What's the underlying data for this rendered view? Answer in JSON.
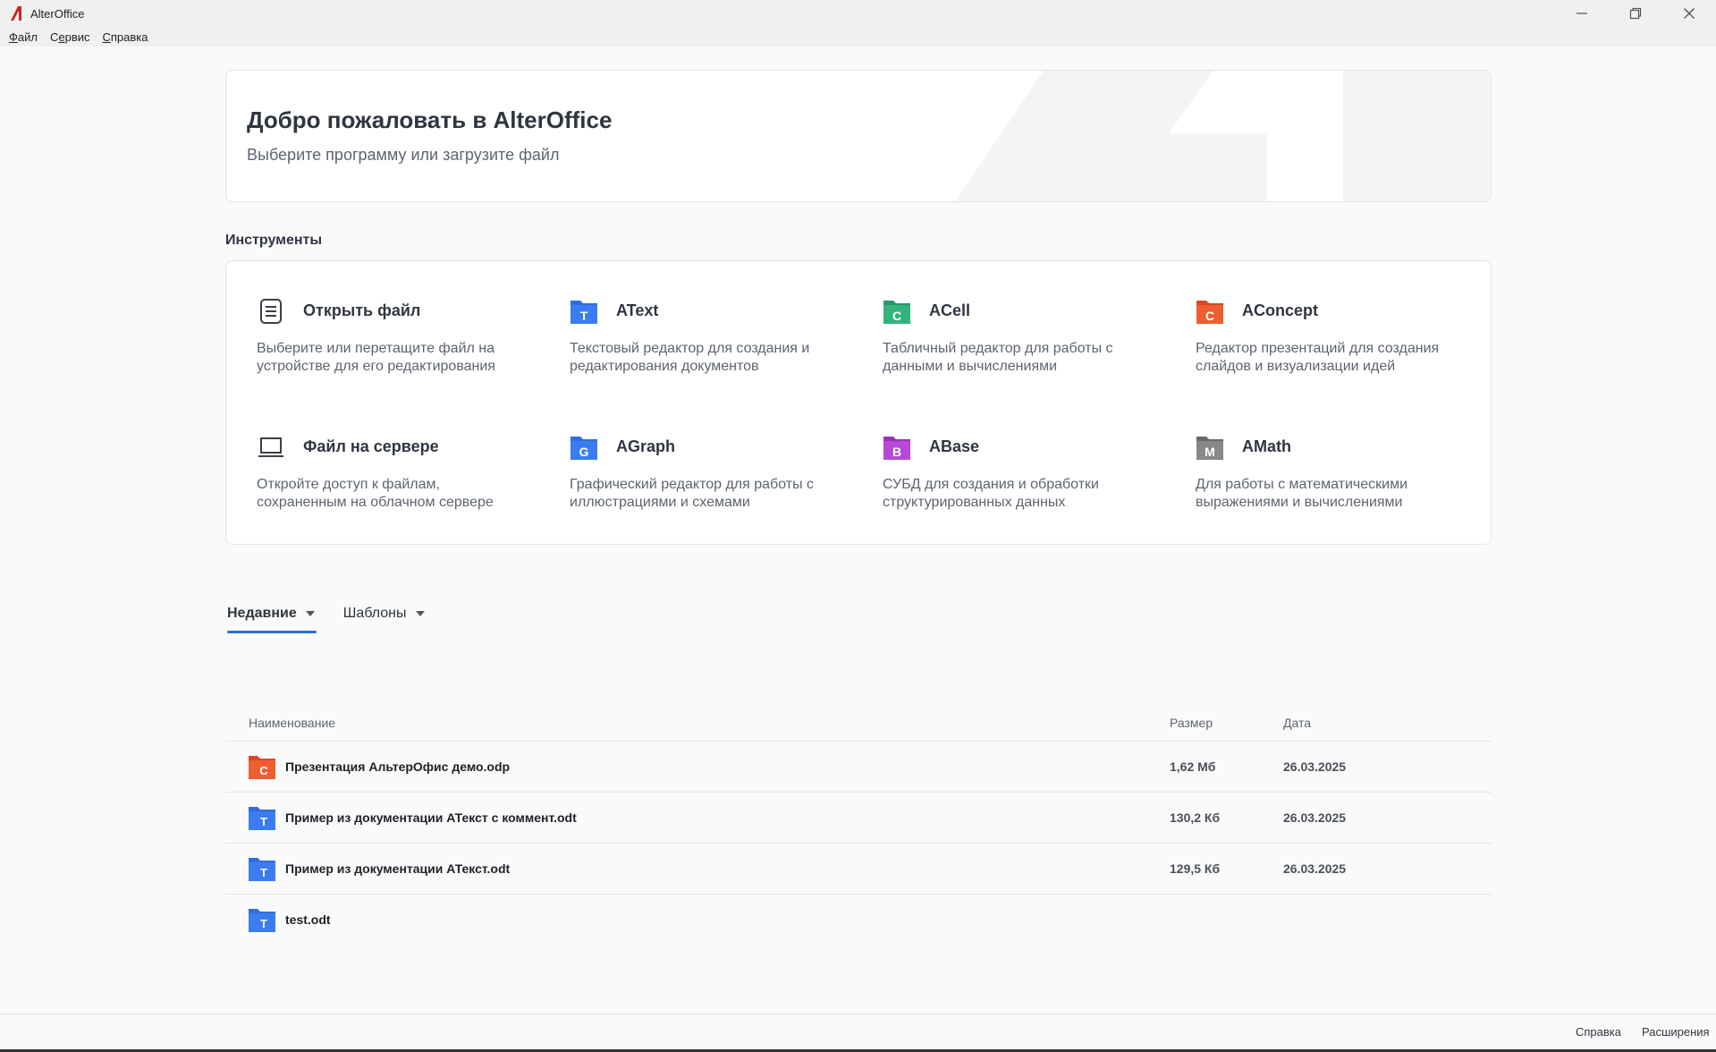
{
  "window": {
    "title": "AlterOffice",
    "accent_color": "#c62828"
  },
  "menu": [
    {
      "label": "Файл",
      "mnemonic": "Ф",
      "rest": "айл"
    },
    {
      "label": "Сервис",
      "mnemonic": "е",
      "prefix": "С",
      "rest": "рвис"
    },
    {
      "label": "Справка",
      "mnemonic": "С",
      "rest": "правка"
    }
  ],
  "welcome": {
    "title": "Добро пожаловать в AlterOffice",
    "subtitle": "Выберите программу или загрузите файл"
  },
  "tools_section": {
    "title": "Инструменты",
    "items": [
      {
        "name": "Открыть файл",
        "desc": "Выберите или перетащите файл на устройстве для его редактирования",
        "icon": "document-icon"
      },
      {
        "name": "AText",
        "desc": "Текстовый редактор для создания и редактирования документов",
        "icon": "atext-icon",
        "letter": "T",
        "color": "#2f6ee0"
      },
      {
        "name": "ACell",
        "desc": "Табличный редактор для работы с данными и вычислениями",
        "icon": "acell-icon",
        "letter": "C",
        "color": "#2eaa72"
      },
      {
        "name": "AConcept",
        "desc": "Редактор презентаций для создания слайдов и визуализации идей",
        "icon": "aconcept-icon",
        "letter": "C",
        "color": "#e8552a"
      },
      {
        "name": "Файл на сервере",
        "desc": "Откройте доступ к файлам, сохраненным на облачном сервере",
        "icon": "laptop-icon"
      },
      {
        "name": "AGraph",
        "desc": "Графический редактор для работы с иллюстрациями и схемами",
        "icon": "agraph-icon",
        "letter": "G",
        "color": "#2f6ee0"
      },
      {
        "name": "ABase",
        "desc": "СУБД для создания и обработки структурированных данных",
        "icon": "abase-icon",
        "letter": "B",
        "color": "#b53fd0"
      },
      {
        "name": "AMath",
        "desc": "Для работы с математическими выражениями и вычислениями",
        "icon": "amath-icon",
        "letter": "M",
        "color": "#7a7a7a"
      }
    ]
  },
  "tabs": [
    {
      "label": "Недавние",
      "active": true
    },
    {
      "label": "Шаблоны",
      "active": false
    }
  ],
  "files": {
    "headers": {
      "name": "Наименование",
      "size": "Размер",
      "date": "Дата"
    },
    "rows": [
      {
        "name": "Презентация АльтерОфис демо.odp",
        "size": "1,62 Мб",
        "date": "26.03.2025",
        "type": "presentation",
        "letter": "C",
        "color": "#e8552a"
      },
      {
        "name": "Пример из документации АТекст с коммент.odt",
        "size": "130,2 Кб",
        "date": "26.03.2025",
        "type": "text",
        "letter": "T",
        "color": "#2f6ee0"
      },
      {
        "name": "Пример из документации АТекст.odt",
        "size": "129,5 Кб",
        "date": "26.03.2025",
        "type": "text",
        "letter": "T",
        "color": "#2f6ee0"
      },
      {
        "name": "test.odt",
        "size": "",
        "date": "",
        "type": "text",
        "letter": "T",
        "color": "#2f6ee0"
      }
    ]
  },
  "status": {
    "help": "Справка",
    "extensions": "Расширения"
  }
}
